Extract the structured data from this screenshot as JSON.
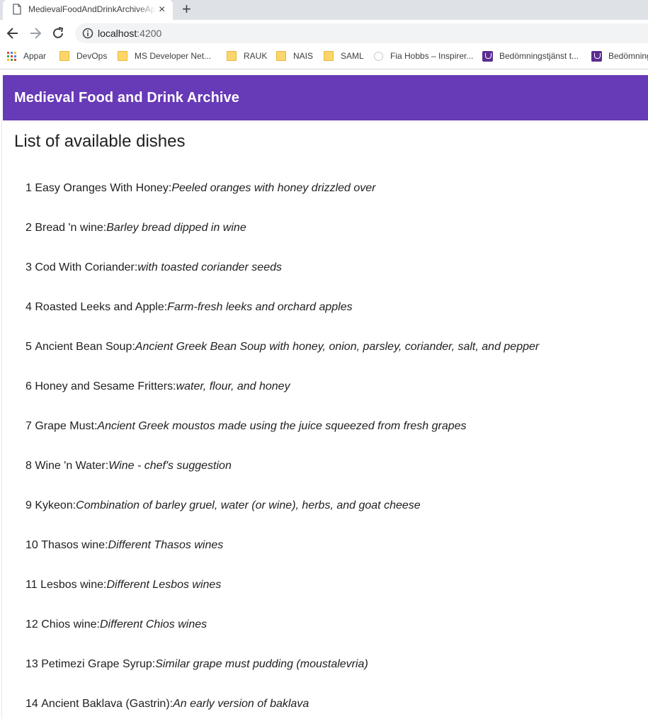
{
  "browser": {
    "tab_title": "MedievalFoodAndDrinkArchiveApp",
    "tab_close": "×",
    "new_tab": "+",
    "url_host": "localhost",
    "url_port": ":4200",
    "bookmarks": [
      {
        "label": "Appar",
        "icon": "apps-icon"
      },
      {
        "label": "DevOps",
        "icon": "folder-icon"
      },
      {
        "label": "MS Developer Net...",
        "icon": "folder-icon"
      },
      {
        "label": "RAUK",
        "icon": "folder-icon"
      },
      {
        "label": "NAIS",
        "icon": "folder-icon"
      },
      {
        "label": "SAML",
        "icon": "folder-icon"
      },
      {
        "label": "Fia Hobbs – Inspirer...",
        "icon": "globe-icon"
      },
      {
        "label": "Bedömningstjänst t...",
        "icon": "shield-icon"
      },
      {
        "label": "Bedömning",
        "icon": "shield-icon"
      }
    ]
  },
  "app": {
    "title": "Medieval Food and Drink Archive",
    "heading": "List of available dishes",
    "accent_color": "#673ab7",
    "dishes": [
      {
        "id": "1",
        "name": "Easy Oranges With Honey:",
        "description": "Peeled oranges with honey drizzled over"
      },
      {
        "id": "2",
        "name": "Bread 'n wine:",
        "description": "Barley bread dipped in wine"
      },
      {
        "id": "3",
        "name": "Cod With Coriander:",
        "description": "with toasted coriander seeds"
      },
      {
        "id": "4",
        "name": "Roasted Leeks and Apple:",
        "description": "Farm-fresh leeks and orchard apples"
      },
      {
        "id": "5",
        "name": "Ancient Bean Soup:",
        "description": "Ancient Greek Bean Soup with honey, onion, parsley, coriander, salt, and pepper"
      },
      {
        "id": "6",
        "name": "Honey and Sesame Fritters:",
        "description": "water, flour, and honey"
      },
      {
        "id": "7",
        "name": "Grape Must:",
        "description": "Ancient Greek moustos made using the juice squeezed from fresh grapes"
      },
      {
        "id": "8",
        "name": "Wine 'n Water:",
        "description": "Wine - chef's suggestion"
      },
      {
        "id": "9",
        "name": "Kykeon:",
        "description": "Combination of barley gruel, water (or wine), herbs, and goat cheese"
      },
      {
        "id": "10",
        "name": "Thasos wine:",
        "description": "Different Thasos wines"
      },
      {
        "id": "11",
        "name": "Lesbos wine:",
        "description": "Different Lesbos wines"
      },
      {
        "id": "12",
        "name": "Chios wine:",
        "description": "Different Chios wines"
      },
      {
        "id": "13",
        "name": "Petimezi Grape Syrup:",
        "description": "Similar grape must pudding (moustalevria)"
      },
      {
        "id": "14",
        "name": "Ancient Baklava (Gastrin):",
        "description": "An early version of baklava"
      }
    ]
  }
}
